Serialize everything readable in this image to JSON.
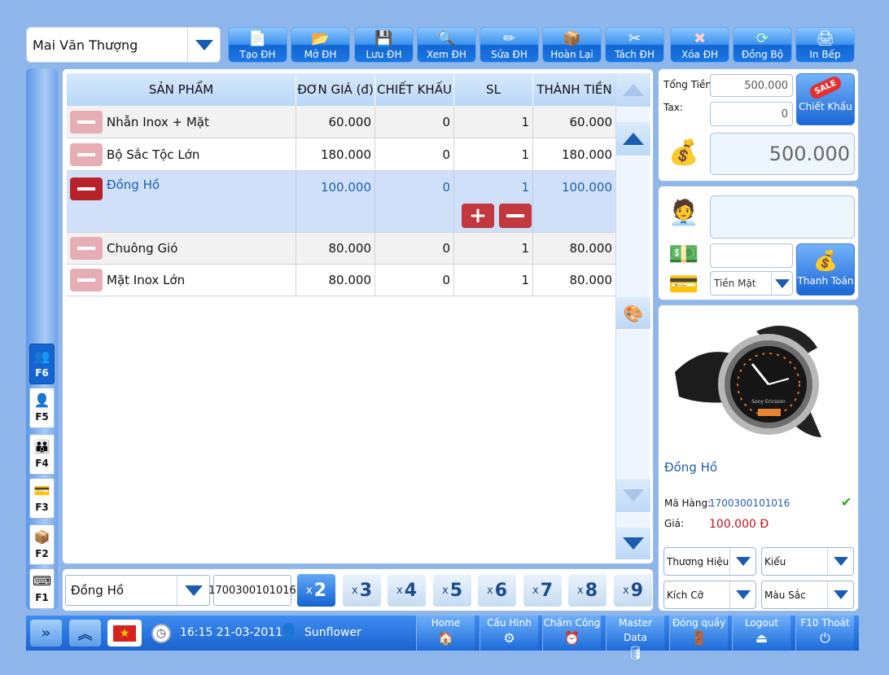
{
  "user_select": {
    "value": "Mai Văn Thượng"
  },
  "toolbar": [
    {
      "label": "Tạo ĐH",
      "icon": "new-order-icon",
      "glyph": "📄"
    },
    {
      "label": "Mở ĐH",
      "icon": "open-order-icon",
      "glyph": "📂"
    },
    {
      "label": "Lưu ĐH",
      "icon": "save-icon",
      "glyph": "💾"
    },
    {
      "label": "Xem ĐH",
      "icon": "view-order-icon",
      "glyph": "🔍"
    },
    {
      "label": "Sửa ĐH",
      "icon": "edit-pencil-icon",
      "glyph": "✏"
    },
    {
      "label": "Hoàn Lại",
      "icon": "return-box-icon",
      "glyph": "📦"
    },
    {
      "label": "Tách ĐH",
      "icon": "split-scissors-icon",
      "glyph": "✂"
    },
    {
      "label": "Xóa ĐH",
      "icon": "delete-icon",
      "glyph": "✖"
    },
    {
      "label": "Đồng Bộ",
      "icon": "sync-icon",
      "glyph": "⟳"
    },
    {
      "label": "In Bếp",
      "icon": "printer-icon",
      "glyph": "🖨"
    }
  ],
  "sidebar": [
    {
      "key": "F6",
      "icon": "add-customer-icon",
      "glyph": "👥"
    },
    {
      "key": "F5",
      "icon": "staff-icon",
      "glyph": "👤"
    },
    {
      "key": "F4",
      "icon": "customers-group-icon",
      "glyph": "👪"
    },
    {
      "key": "F3",
      "icon": "payment-icon",
      "glyph": "💳"
    },
    {
      "key": "F2",
      "icon": "products-box-icon",
      "glyph": "📦"
    },
    {
      "key": "F1",
      "icon": "keyboard-icon",
      "glyph": "⌨"
    }
  ],
  "table": {
    "headers": [
      "SẢN PHẨM",
      "ĐƠN GIÁ (đ)",
      "CHIẾT KHẤU",
      "SL",
      "THÀNH TIỀN"
    ],
    "rows": [
      {
        "name": "Nhẫn Inox + Mặt",
        "price": "60.000",
        "discount": "0",
        "qty": "1",
        "total": "60.000"
      },
      {
        "name": "Bộ Sắc Tộc Lớn",
        "price": "180.000",
        "discount": "0",
        "qty": "1",
        "total": "180.000"
      },
      {
        "name": "Đồng Hồ",
        "price": "100.000",
        "discount": "0",
        "qty": "1",
        "total": "100.000"
      },
      {
        "name": "Chuông Gió",
        "price": "80.000",
        "discount": "0",
        "qty": "1",
        "total": "80.000"
      },
      {
        "name": "Mặt Inox Lớn",
        "price": "80.000",
        "discount": "0",
        "qty": "1",
        "total": "80.000"
      }
    ],
    "selected_row": "Đồng Hồ"
  },
  "bottom": {
    "product_select": "Đồng Hồ",
    "sku": "1700300101016",
    "multipliers": [
      "2",
      "3",
      "4",
      "5",
      "6",
      "7",
      "8",
      "9"
    ],
    "active_multiplier": "2",
    "x_label": "x"
  },
  "totals": {
    "total_label": "Tổng Tiền",
    "total_value": "500.000",
    "tax_label": "Tax:",
    "tax_value": "0",
    "discount_button": "Chiết Khấu",
    "sale_tag": "SALE",
    "grand_total": "500.000"
  },
  "payment": {
    "customer_value": "",
    "cash_value": "",
    "method": "Tiền Mặt",
    "pay_button": "Thanh Toán"
  },
  "product_detail": {
    "name": "Đồng Hồ",
    "sku_label": "Mã Hàng:",
    "sku_value": "1700300101016",
    "price_label": "Giá:",
    "price_value": "100.000 Đ",
    "watch_brand": "Sony Ericsson",
    "filters": [
      "Thương Hiệu",
      "Kiểu",
      "Kích Cỡ",
      "Màu Sắc"
    ]
  },
  "taskbar": {
    "datetime": "16:15 21-03-2011",
    "user": "Sunflower",
    "nav": [
      {
        "label": "Home",
        "icon": "home-icon",
        "glyph": "🏠"
      },
      {
        "label": "Cấu Hình",
        "icon": "config-icon",
        "glyph": "⚙"
      },
      {
        "label": "Chấm Công",
        "icon": "alarm-clock-icon",
        "glyph": "⏰"
      },
      {
        "label": "Master Data",
        "icon": "database-icon",
        "glyph": "🛢"
      },
      {
        "label": "Đóng quầy",
        "icon": "close-counter-icon",
        "glyph": "🚪"
      },
      {
        "label": "Logout",
        "icon": "logout-icon",
        "glyph": "⏏"
      },
      {
        "label": "F10  Thoát",
        "icon": "power-icon",
        "glyph": "⏻"
      }
    ]
  },
  "colors": {
    "background": "#8eb6ea",
    "accent_blue": "#1a5cb0",
    "selected_row": "#cfe0f8",
    "delete_red": "#b8232b",
    "price_red": "#c0101a"
  }
}
